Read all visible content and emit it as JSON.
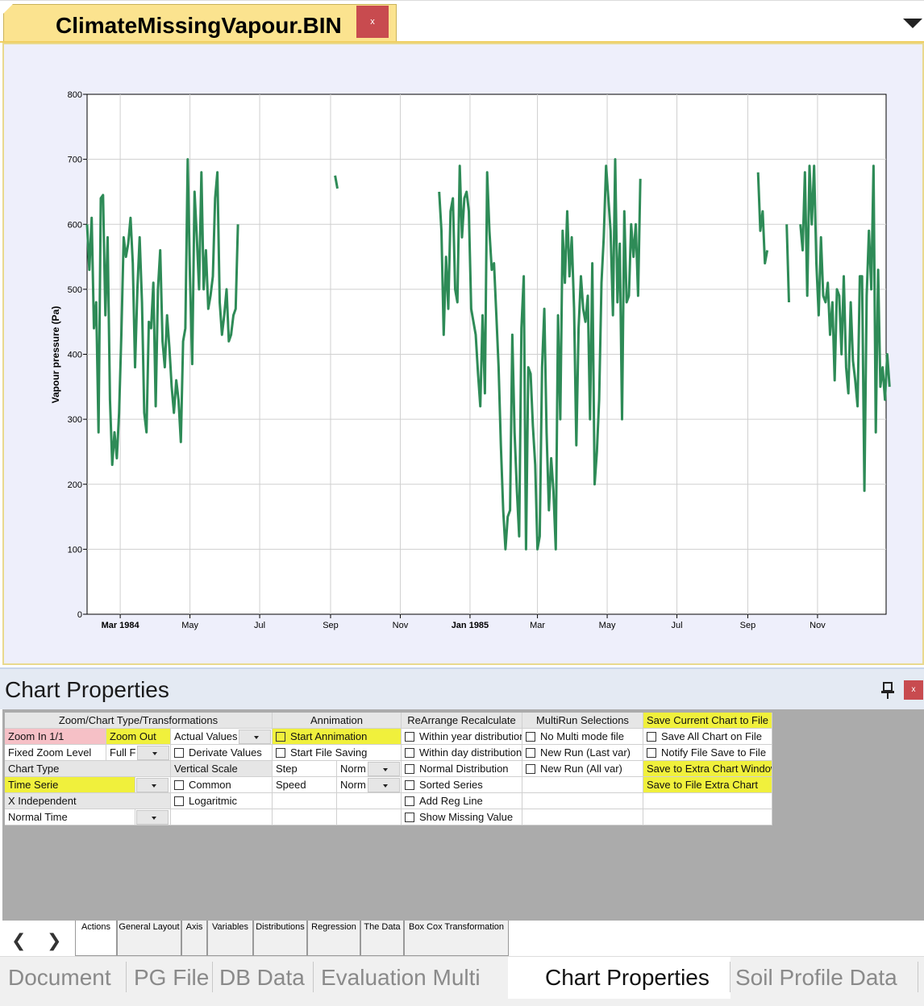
{
  "document_tab": {
    "title": "ClimateMissingVapour.BIN",
    "close_label": "x"
  },
  "chart_data": {
    "type": "line",
    "title": "",
    "xlabel": "",
    "ylabel": "Vapour pressure (Pa)",
    "ylim": [
      0,
      800
    ],
    "yticks": [
      0,
      100,
      200,
      300,
      400,
      500,
      600,
      700,
      800
    ],
    "xlim": [
      "1984-02-01",
      "1985-12-31"
    ],
    "xticks": [
      {
        "date": "1984-03-01",
        "label": "Mar 1984",
        "bold": true
      },
      {
        "date": "1984-05-01",
        "label": "May",
        "bold": false
      },
      {
        "date": "1984-07-01",
        "label": "Jul",
        "bold": false
      },
      {
        "date": "1984-09-01",
        "label": "Sep",
        "bold": false
      },
      {
        "date": "1984-11-01",
        "label": "Nov",
        "bold": false
      },
      {
        "date": "1985-01-01",
        "label": "Jan 1985",
        "bold": true
      },
      {
        "date": "1985-03-01",
        "label": "Mar",
        "bold": false
      },
      {
        "date": "1985-05-01",
        "label": "May",
        "bold": false
      },
      {
        "date": "1985-07-01",
        "label": "Jul",
        "bold": false
      },
      {
        "date": "1985-09-01",
        "label": "Sep",
        "bold": false
      },
      {
        "date": "1985-11-01",
        "label": "Nov",
        "bold": false
      }
    ],
    "grid": true,
    "series": [
      {
        "color": "#2e8b57",
        "segments": [
          {
            "start": "1984-02-01",
            "values": [
              600,
              530,
              610,
              440,
              480,
              280,
              640,
              645,
              460,
              580,
              330,
              230,
              280,
              240,
              310,
              430,
              580,
              550,
              570,
              610,
              540,
              380,
              500,
              580,
              480,
              310,
              280,
              450,
              440,
              510,
              320,
              500,
              560,
              420,
              380,
              460,
              410,
              350,
              310,
              360,
              330,
              265,
              420,
              440,
              700,
              520,
              385,
              650,
              580,
              500,
              680,
              500,
              560,
              470,
              490,
              520,
              640,
              680,
              480,
              430,
              460,
              500,
              420,
              430,
              460,
              470,
              600
            ]
          },
          {
            "start": "1984-09-05",
            "values": [
              675,
              655
            ]
          },
          {
            "start": "1984-12-05",
            "values": [
              650,
              590,
              430,
              550,
              470,
              620,
              640,
              500,
              480,
              690,
              580,
              640,
              650,
              620,
              470,
              450,
              430,
              370,
              320,
              460,
              340,
              680,
              590,
              530,
              540,
              460,
              380,
              260,
              160,
              100,
              150,
              160,
              430,
              280,
              190,
              120,
              440,
              520,
              100,
              380,
              370,
              290,
              230,
              100,
              120,
              380,
              470,
              280,
              160,
              240,
              190,
              100,
              460,
              300,
              590,
              510,
              620,
              520,
              580,
              470,
              260,
              440,
              520,
              470,
              450,
              490,
              300,
              540,
              200,
              250,
              330,
              510,
              580,
              690,
              640,
              590,
              460,
              700,
              480,
              570,
              300,
              620,
              480,
              490,
              600,
              550,
              600,
              490,
              670
            ]
          },
          {
            "start": "1985-09-10",
            "values": [
              680,
              590,
              620,
              540,
              560
            ]
          },
          {
            "start": "1985-10-05",
            "values": [
              600,
              480
            ]
          },
          {
            "start": "1985-10-17",
            "values": [
              600,
              560,
              680,
              490,
              690,
              600,
              690,
              540,
              460,
              580,
              490,
              480,
              510,
              430,
              480,
              360,
              500,
              490,
              400,
              520,
              380,
              340,
              480,
              390,
              360,
              320,
              520,
              520,
              190,
              490,
              590,
              500,
              690,
              280,
              530,
              350,
              380,
              330,
              400,
              350
            ]
          }
        ]
      }
    ]
  },
  "props_header": {
    "title": "Chart Properties",
    "close_label": "x"
  },
  "grid": {
    "col1_header": "Zoom/Chart Type/Transformations",
    "zoom_in": "Zoom In 1/1",
    "zoom_out": "Zoom Out",
    "actual_values": "Actual Values",
    "fixed_zoom_level": "Fixed Zoom Level",
    "full_f": "Full F",
    "derivate_values": "Derivate Values",
    "chart_type": "Chart Type",
    "vertical_scale": "Vertical Scale",
    "time_serie": "Time Serie",
    "common": "Common",
    "x_independent": "X Independent",
    "logaritmic": "Logaritmic",
    "normal_time": "Normal Time",
    "col2_header": "Animation",
    "anim_header": "Annimation",
    "start_animation": "Start Annimation",
    "start_file_saving": "Start File Saving",
    "step": "Step",
    "step_value": "Norm",
    "speed": "Speed",
    "speed_value": "Norm",
    "col3_header": "ReArrange Recalculate",
    "within_year": "Within year distribution",
    "within_day": "Within day distribution",
    "normal_distribution": "Normal Distribution",
    "sorted_series": "Sorted Series",
    "add_reg_line": "Add Reg Line",
    "show_missing": "Show Missing Value",
    "col4_header": "MultiRun Selections",
    "no_multi": "No Multi mode file",
    "new_run_last": "New Run (Last var)",
    "new_run_all": "New Run (All var)",
    "save_current": "Save Current Chart to File",
    "save_all": "Save All Chart on File",
    "notify_file": "Notify File Save to File",
    "save_extra_window": "Save to Extra Chart Window",
    "save_file_extra": "Save to File Extra Chart"
  },
  "sheet_tabs": [
    "Actions",
    "General Layout",
    "Axis",
    "Variables",
    "Distributions",
    "Regression",
    "The Data",
    "Box Cox Transformation"
  ],
  "dock_tabs": [
    "Document",
    "PG File",
    "DB Data",
    "Evaluation Multi",
    "Chart Properties",
    "Soil Profile Data"
  ]
}
